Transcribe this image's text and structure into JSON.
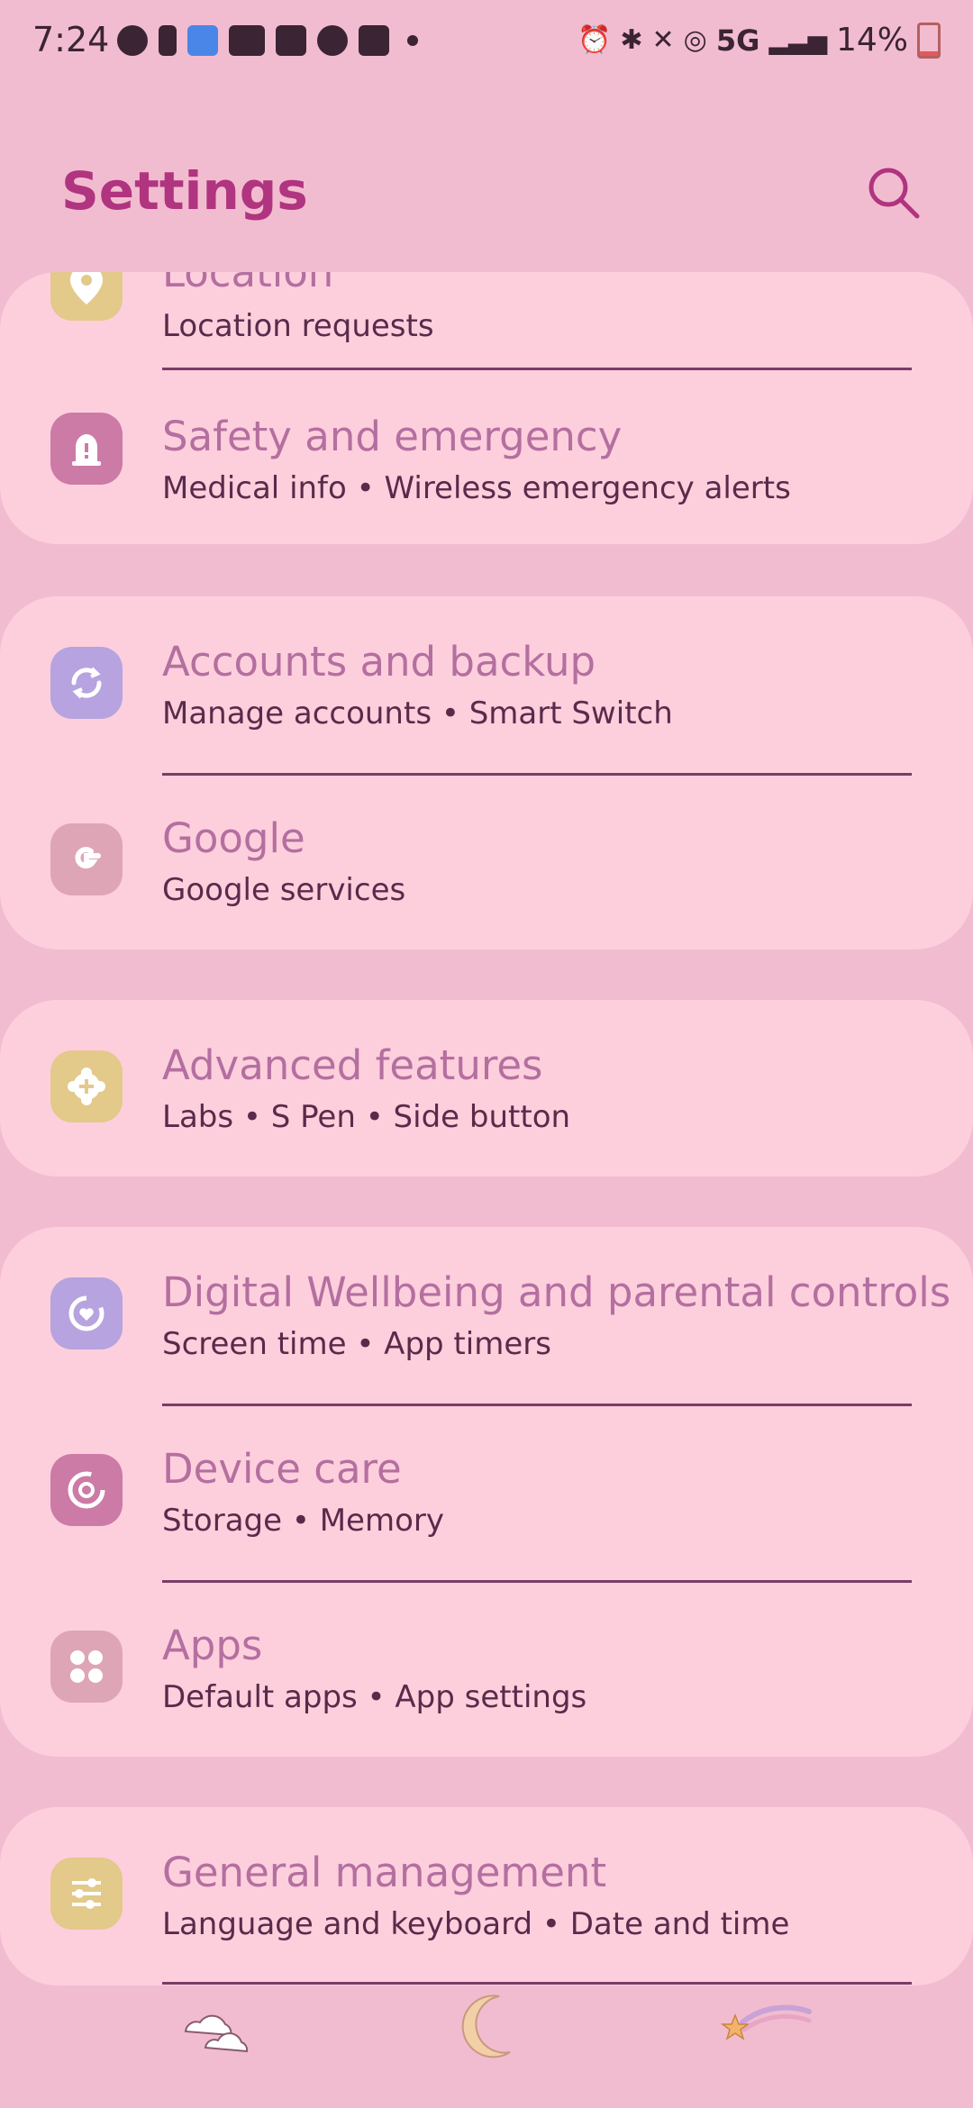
{
  "status_bar": {
    "time": "7:24",
    "network": "5G",
    "battery": "14%",
    "left_icons": [
      "messages-icon",
      "battery-alert-icon",
      "cake-icon",
      "youtube-icon",
      "linkedin-icon",
      "alarm-icon",
      "outlook-icon"
    ],
    "right_icons": [
      "alarm-icon",
      "bluetooth-icon",
      "mute-icon",
      "hotspot-icon",
      "signal-icon",
      "battery-icon"
    ]
  },
  "header": {
    "title": "Settings"
  },
  "cards": [
    {
      "items": [
        {
          "title": "Location",
          "subtitle": "Location requests",
          "icon": "location-icon",
          "color": "#e3c98a"
        },
        {
          "title": "Safety and emergency",
          "subtitle": "Medical info  •  Wireless emergency alerts",
          "icon": "siren-icon",
          "color": "#cc7aa6"
        }
      ]
    },
    {
      "items": [
        {
          "title": "Accounts and backup",
          "subtitle": "Manage accounts  •  Smart Switch",
          "icon": "sync-icon",
          "color": "#b6a3df"
        },
        {
          "title": "Google",
          "subtitle": "Google services",
          "icon": "google-icon",
          "color": "#dea5b6"
        }
      ]
    },
    {
      "items": [
        {
          "title": "Advanced features",
          "subtitle": "Labs  •  S Pen  •  Side button",
          "icon": "gear-plus-icon",
          "color": "#e3c98a"
        }
      ]
    },
    {
      "items": [
        {
          "title": "Digital Wellbeing and parental controls",
          "subtitle": "Screen time  •  App timers",
          "icon": "wellbeing-icon",
          "color": "#b6a3df"
        },
        {
          "title": "Device care",
          "subtitle": "Storage  •  Memory",
          "icon": "device-care-icon",
          "color": "#cc7aa6"
        },
        {
          "title": "Apps",
          "subtitle": "Default apps  •  App settings",
          "icon": "apps-icon",
          "color": "#dea5b6"
        }
      ]
    },
    {
      "items": [
        {
          "title": "General management",
          "subtitle": "Language and keyboard  •  Date and time",
          "icon": "sliders-icon",
          "color": "#e3c98a"
        }
      ]
    }
  ],
  "bottom_nav": [
    "cloud-icon",
    "moon-icon",
    "shooting-star-icon"
  ]
}
